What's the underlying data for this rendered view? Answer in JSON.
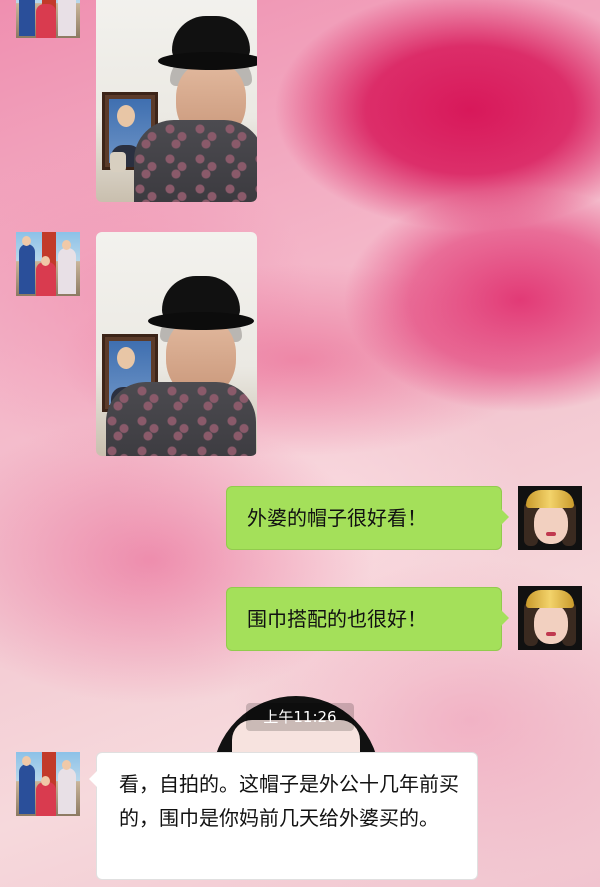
{
  "chat": {
    "messages": [
      {
        "from": "contact",
        "type": "image",
        "description": "selfie"
      },
      {
        "from": "contact",
        "type": "image",
        "description": "selfie"
      },
      {
        "from": "me",
        "type": "text",
        "text": "外婆的帽子很好看！"
      },
      {
        "from": "me",
        "type": "text",
        "text": "围巾搭配的也很好！"
      },
      {
        "from": "system",
        "type": "timestamp",
        "text": "上午11:26"
      },
      {
        "from": "contact",
        "type": "text",
        "text": "看，自拍的。这帽子是外公十几年前买的，围巾是你妈前几天给外婆买的。"
      }
    ]
  },
  "colors": {
    "outgoing_bubble": "#a4e05a",
    "incoming_bubble": "#ffffff",
    "background_accent": "#d8185a"
  }
}
